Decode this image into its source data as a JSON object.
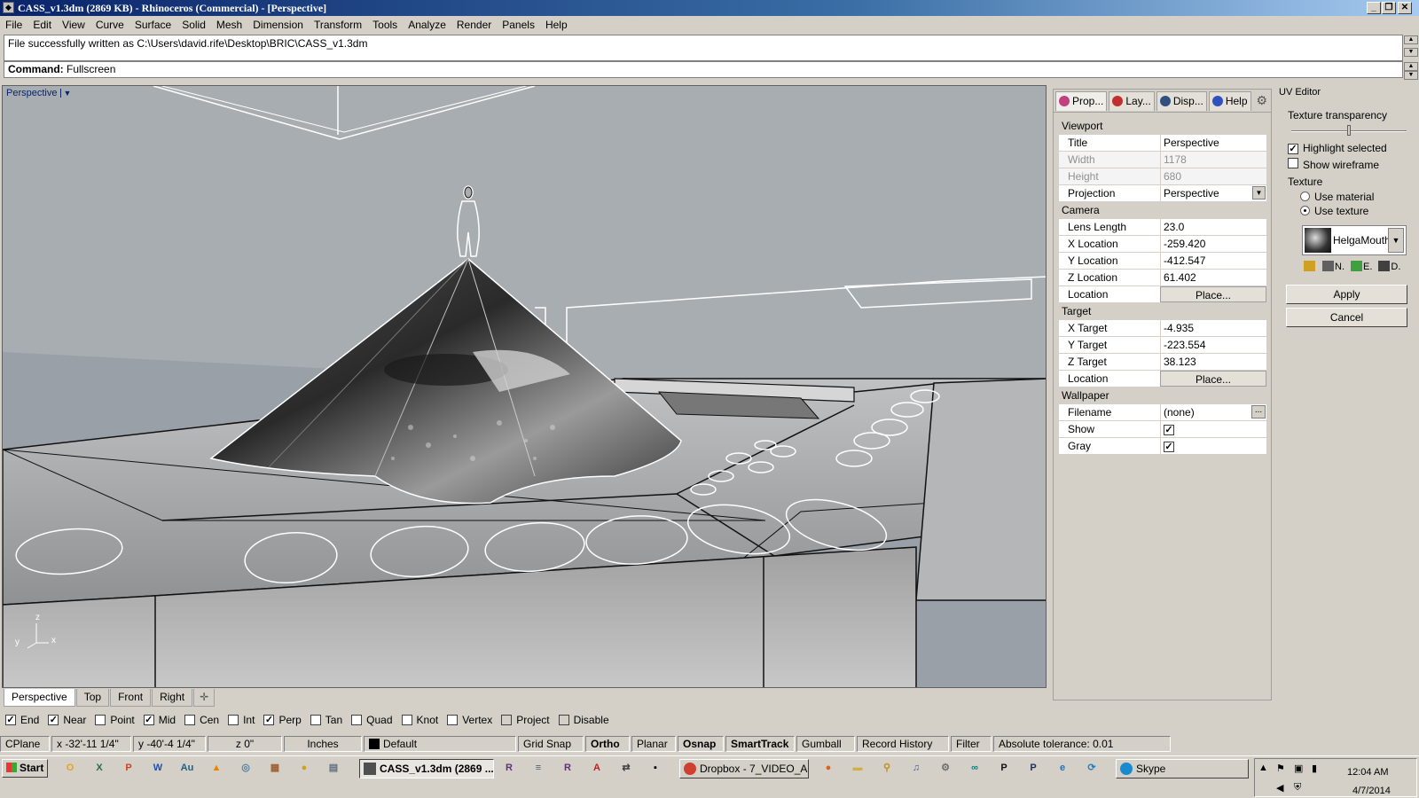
{
  "window": {
    "title": "CASS_v1.3dm (2869 KB) - Rhinoceros (Commercial) - [Perspective]",
    "icon": "rhino-icon",
    "controls": [
      "minimize-icon",
      "restore-icon",
      "close-icon"
    ]
  },
  "menu": [
    "File",
    "Edit",
    "View",
    "Curve",
    "Surface",
    "Solid",
    "Mesh",
    "Dimension",
    "Transform",
    "Tools",
    "Analyze",
    "Render",
    "Panels",
    "Help"
  ],
  "command": {
    "history": "File successfully written as C:\\Users\\david.rife\\Desktop\\BRIC\\CASS_v1.3dm",
    "prompt_label": "Command:",
    "prompt_value": "Fullscreen"
  },
  "viewport": {
    "label": "Perspective",
    "axis_x": "x",
    "axis_y": "y",
    "axis_z": "z",
    "tabs": [
      "Perspective",
      "Top",
      "Front",
      "Right"
    ],
    "active_tab": "Perspective"
  },
  "osnap": [
    {
      "label": "End",
      "checked": true
    },
    {
      "label": "Near",
      "checked": true
    },
    {
      "label": "Point",
      "checked": false
    },
    {
      "label": "Mid",
      "checked": true
    },
    {
      "label": "Cen",
      "checked": false
    },
    {
      "label": "Int",
      "checked": false
    },
    {
      "label": "Perp",
      "checked": true
    },
    {
      "label": "Tan",
      "checked": false
    },
    {
      "label": "Quad",
      "checked": false
    },
    {
      "label": "Knot",
      "checked": false
    },
    {
      "label": "Vertex",
      "checked": false
    },
    {
      "label": "Project",
      "checked": false
    },
    {
      "label": "Disable",
      "checked": false
    }
  ],
  "status": {
    "cplane": "CPlane",
    "x": "x -32'-11 1/4\"",
    "y": "y -40'-4 1/4\"",
    "z": "z 0\"",
    "units": "Inches",
    "layer": "Default",
    "grid_snap": "Grid Snap",
    "ortho": "Ortho",
    "planar": "Planar",
    "osnap": "Osnap",
    "smarttrack": "SmartTrack",
    "gumball": "Gumball",
    "record_history": "Record History",
    "filter": "Filter",
    "tolerance": "Absolute tolerance: 0.01"
  },
  "properties": {
    "tabs": [
      {
        "label": "Prop...",
        "icon": "properties-icon",
        "color": "#c04080"
      },
      {
        "label": "Lay...",
        "icon": "layers-icon",
        "color": "#c03030"
      },
      {
        "label": "Disp...",
        "icon": "display-icon",
        "color": "#305080"
      },
      {
        "label": "Help",
        "icon": "help-icon",
        "color": "#3050c0"
      }
    ],
    "sections": {
      "viewport": "Viewport",
      "camera": "Camera",
      "target": "Target",
      "wallpaper": "Wallpaper"
    },
    "title_label": "Title",
    "title_value": "Perspective",
    "width_label": "Width",
    "width_value": "1178",
    "height_label": "Height",
    "height_value": "680",
    "projection_label": "Projection",
    "projection_value": "Perspective",
    "lens_label": "Lens Length",
    "lens_value": "23.0",
    "xloc_label": "X Location",
    "xloc_value": "-259.420",
    "yloc_label": "Y Location",
    "yloc_value": "-412.547",
    "zloc_label": "Z Location",
    "zloc_value": "61.402",
    "cam_location_label": "Location",
    "cam_location_button": "Place...",
    "xt_label": "X Target",
    "xt_value": "-4.935",
    "yt_label": "Y Target",
    "yt_value": "-223.554",
    "zt_label": "Z Target",
    "zt_value": "38.123",
    "tgt_location_label": "Location",
    "tgt_location_button": "Place...",
    "filename_label": "Filename",
    "filename_value": "(none)",
    "filename_browse": "...",
    "show_label": "Show",
    "show_checked": true,
    "gray_label": "Gray",
    "gray_checked": true
  },
  "uv_editor": {
    "title": "UV Editor",
    "transparency_label": "Texture transparency",
    "transparency_level": 0.5,
    "highlight_label": "Highlight selected",
    "highlight_checked": true,
    "wireframe_label": "Show wireframe",
    "wireframe_checked": false,
    "texture_label": "Texture",
    "use_material": "Use material",
    "use_texture": "Use texture",
    "selected_option": "Use texture",
    "texture_name": "HelgaMouth",
    "tools": [
      {
        "label": "",
        "icon": "folder-icon"
      },
      {
        "label": "N.",
        "icon": "new-icon"
      },
      {
        "label": "E.",
        "icon": "edit-icon"
      },
      {
        "label": "D.",
        "icon": "duplicate-icon"
      }
    ],
    "apply": "Apply",
    "cancel": "Cancel"
  },
  "taskbar": {
    "start": "Start",
    "quick_launch": [
      {
        "icon": "outlook-icon",
        "glyph": "O",
        "color": "#e8a020"
      },
      {
        "icon": "excel-icon",
        "glyph": "X",
        "color": "#207040"
      },
      {
        "icon": "powerpoint-icon",
        "glyph": "P",
        "color": "#d04020"
      },
      {
        "icon": "word-icon",
        "glyph": "W",
        "color": "#2050b0"
      },
      {
        "icon": "audition-icon",
        "glyph": "Au",
        "color": "#206080"
      },
      {
        "icon": "vlc-icon",
        "glyph": "▲",
        "color": "#f08000"
      },
      {
        "icon": "app-icon-1",
        "glyph": "◎",
        "color": "#5080a0"
      },
      {
        "icon": "app-icon-2",
        "glyph": "▦",
        "color": "#a06030"
      },
      {
        "icon": "app-icon-3",
        "glyph": "●",
        "color": "#d0a020"
      },
      {
        "icon": "app-icon-4",
        "glyph": "▤",
        "color": "#607080"
      }
    ],
    "tasks": [
      {
        "label": "CASS_v1.3dm (2869 ...",
        "icon": "rhino-icon",
        "active": true
      },
      {
        "label": "Dropbox - 7_VIDEO_A...",
        "icon": "chrome-icon",
        "active": false
      },
      {
        "label": "Skype",
        "icon": "skype-icon",
        "active": false
      }
    ],
    "mid_icons": [
      {
        "icon": "app-icon-5",
        "glyph": "R",
        "color": "#603080"
      },
      {
        "icon": "app-icon-6",
        "glyph": "≡",
        "color": "#506070"
      },
      {
        "icon": "app-icon-7",
        "glyph": "R",
        "color": "#603080"
      },
      {
        "icon": "acrobat-icon",
        "glyph": "A",
        "color": "#c02020"
      },
      {
        "icon": "switch-icon",
        "glyph": "⇄",
        "color": "#404040"
      },
      {
        "icon": "cmd-icon",
        "glyph": "▪",
        "color": "#000000"
      }
    ],
    "right_icons": [
      {
        "icon": "firefox-icon",
        "glyph": "●",
        "color": "#e06020"
      },
      {
        "icon": "explorer-icon",
        "glyph": "▬",
        "color": "#d0b040"
      },
      {
        "icon": "search-icon",
        "glyph": "⚲",
        "color": "#c09020"
      },
      {
        "icon": "itunes-icon",
        "glyph": "♫",
        "color": "#4060a0"
      },
      {
        "icon": "settings-icon",
        "glyph": "⚙",
        "color": "#707070"
      },
      {
        "icon": "arduino-icon",
        "glyph": "∞",
        "color": "#008080"
      },
      {
        "icon": "p-icon-1",
        "glyph": "P",
        "color": "#101010"
      },
      {
        "icon": "p-icon-2",
        "glyph": "P",
        "color": "#203060"
      },
      {
        "icon": "ie-icon",
        "glyph": "e",
        "color": "#2070c0"
      },
      {
        "icon": "refresh-icon",
        "glyph": "⟳",
        "color": "#2080c0"
      }
    ],
    "clock": "12:04 AM",
    "date": "4/7/2014"
  }
}
